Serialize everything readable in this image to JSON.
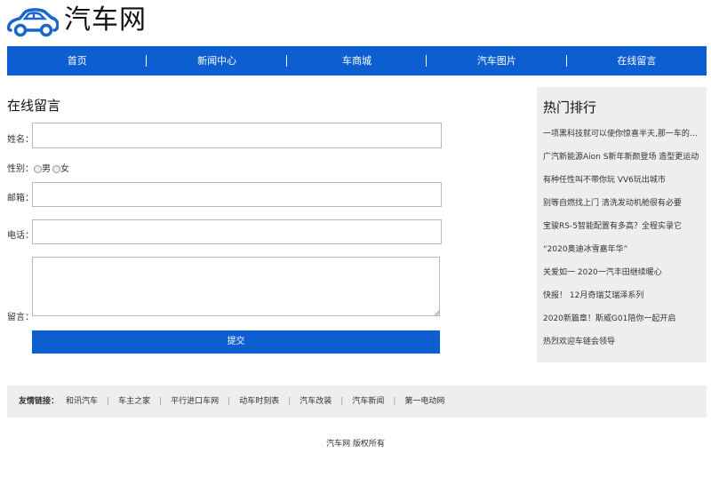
{
  "brand": {
    "name": "汽车网"
  },
  "nav": [
    "首页",
    "新闻中心",
    "车商城",
    "汽车图片",
    "在线留言"
  ],
  "form": {
    "title": "在线留言",
    "name_label": "姓名：",
    "gender_label": "性别：",
    "gender_male": "男",
    "gender_female": "女",
    "email_label": "邮箱：",
    "phone_label": "电话：",
    "message_label": "留言：",
    "submit_label": "提交"
  },
  "sidebar": {
    "title": "热门排行",
    "items": [
      "一项黑科技就可以使你惊喜半天,那一车的问题",
      "广汽新能源Aion S新年新颜登场 造型更运动",
      "有种任性叫不带你玩 VV6玩出城市",
      "别等自燃找上门 清洗发动机舱很有必要",
      "宝骏RS-5智能配置有多高？全程实录它",
      "“2020奥迪冰雪嘉年华”",
      "关爱如一 2020一汽丰田继续暖心",
      "快报！ 12月奇瑞艾瑞泽系列",
      "2020新篇章！斯威G01陪你一起开启",
      "热烈欢迎车链会领导"
    ]
  },
  "links": {
    "label": "友情链接：",
    "items": [
      "和讯汽车",
      "车主之家",
      "平行进口车网",
      "动车时刻表",
      "汽车改装",
      "汽车新闻",
      "第一电动网"
    ]
  },
  "footer": {
    "text": "汽车网 版权所有"
  },
  "colors": {
    "accent": "#0d5fd1",
    "panel": "#eeeeee"
  }
}
